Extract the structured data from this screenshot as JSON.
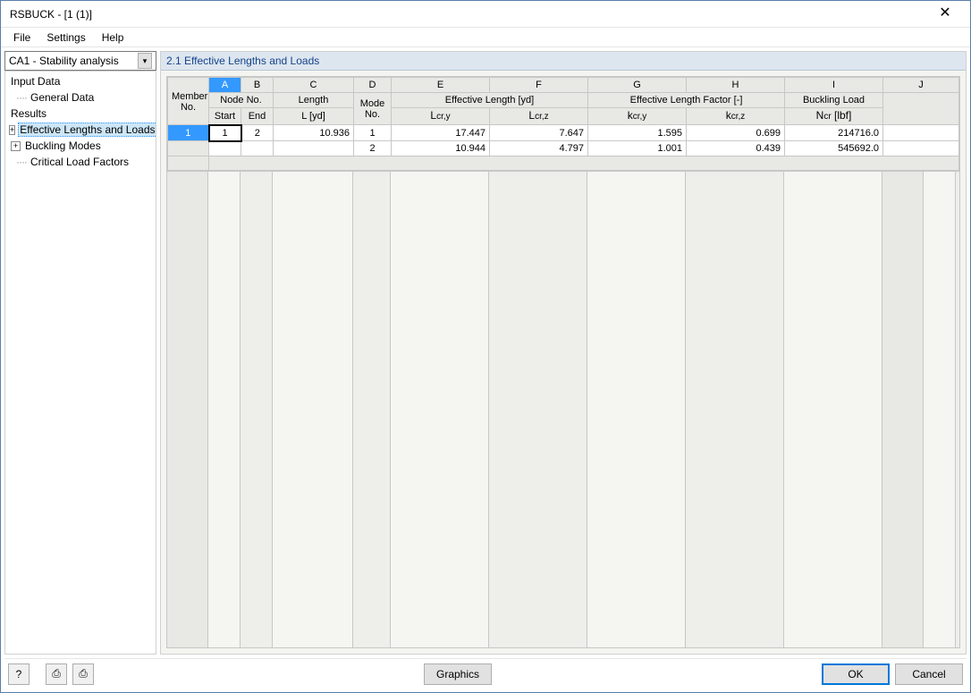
{
  "window": {
    "title": "RSBUCK - [1 (1)]"
  },
  "menu": {
    "file": "File",
    "settings": "Settings",
    "help": "Help"
  },
  "combo": {
    "text": "CA1 - Stability analysis"
  },
  "tree": {
    "input_data": "Input Data",
    "general_data": "General Data",
    "results": "Results",
    "eff_lengths": "Effective Lengths and Loads",
    "buckling_modes": "Buckling Modes",
    "critical_load": "Critical Load Factors"
  },
  "pane": {
    "title": "2.1 Effective Lengths and Loads"
  },
  "cols": {
    "letters": {
      "A": "A",
      "B": "B",
      "C": "C",
      "D": "D",
      "E": "E",
      "F": "F",
      "G": "G",
      "H": "H",
      "I": "I",
      "J": "J"
    },
    "member_no": "Member\nNo.",
    "node_no": "Node No.",
    "start": "Start",
    "end": "End",
    "length": "Length",
    "l_yd": "L [yd]",
    "mode_no": "Mode\nNo.",
    "eff_len": "Effective Length [yd]",
    "lcry": "L",
    "lcry_sub": "cr,y",
    "lcrz": "L",
    "lcrz_sub": "cr,z",
    "eff_fac": "Effective Length Factor [-]",
    "kcry": "k",
    "kcry_sub": "cr,y",
    "kcrz": "k",
    "kcrz_sub": "cr,z",
    "buck_load": "Buckling Load",
    "ncr": "N",
    "ncr_sub": "cr",
    "ncr_unit": " [lbf]"
  },
  "rows": [
    {
      "member": "1",
      "start": "1",
      "end": "2",
      "l": "10.936",
      "mode": "1",
      "lcry": "17.447",
      "lcrz": "7.647",
      "kcry": "1.595",
      "kcrz": "0.699",
      "ncr": "214716.0"
    },
    {
      "member": "",
      "start": "",
      "end": "",
      "l": "",
      "mode": "2",
      "lcry": "10.944",
      "lcrz": "4.797",
      "kcry": "1.001",
      "kcrz": "0.439",
      "ncr": "545692.0"
    }
  ],
  "buttons": {
    "graphics": "Graphics",
    "ok": "OK",
    "cancel": "Cancel"
  },
  "icons": {
    "help": "?",
    "print1": "⎙",
    "print2": "⎙"
  }
}
